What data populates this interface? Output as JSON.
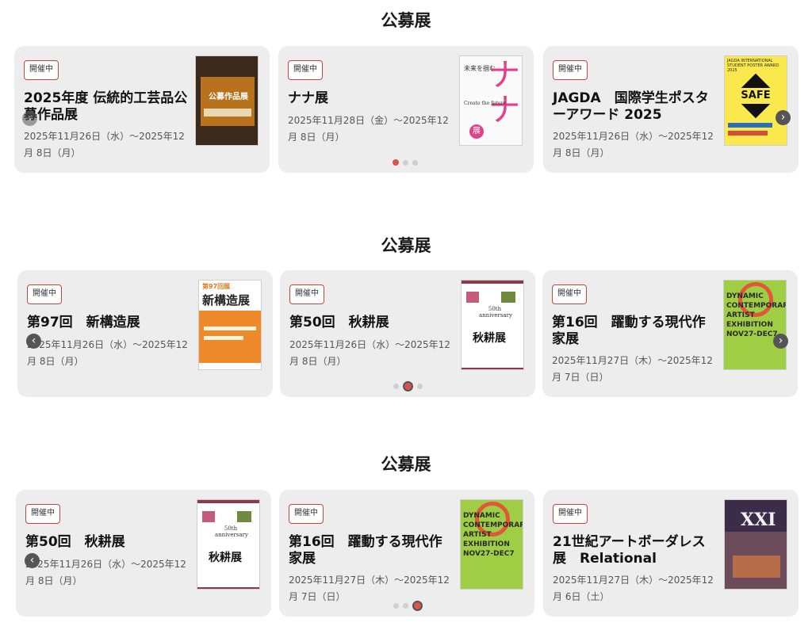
{
  "sections": [
    {
      "title": "公募展",
      "cards": [
        {
          "badge": "開催中",
          "title": "2025年度 伝統的工芸品公募作品展",
          "date": "2025年11月26日（水）～2025年12月 8日（月）"
        },
        {
          "badge": "開催中",
          "title": "ナナ展",
          "date": "2025年11月28日（金）～2025年12月 8日（月）"
        },
        {
          "badge": "開催中",
          "title": "JAGDA　国際学生ポスターアワード 2025",
          "date": "2025年11月26日（水）～2025年12月 8日（月）"
        }
      ]
    },
    {
      "title": "公募展",
      "cards": [
        {
          "badge": "開催中",
          "title": "第97回　新構造展",
          "date": "2025年11月26日（水）～2025年12月 8日（月）"
        },
        {
          "badge": "開催中",
          "title": "第50回　秋耕展",
          "date": "2025年11月26日（水）～2025年12月 8日（月）"
        },
        {
          "badge": "開催中",
          "title": "第16回　躍動する現代作家展",
          "date": "2025年11月27日（木）～2025年12月 7日（日）"
        }
      ]
    },
    {
      "title": "公募展",
      "cards": [
        {
          "badge": "開催中",
          "title": "第50回　秋耕展",
          "date": "2025年11月26日（水）～2025年12月 8日（月）"
        },
        {
          "badge": "開催中",
          "title": "第16回　躍動する現代作家展",
          "date": "2025年11月27日（木）～2025年12月 7日（日）"
        },
        {
          "badge": "開催中",
          "title": "21世紀アートボーダレス展　Relational",
          "date": "2025年11月27日（木）～2025年12月 6日（土）"
        }
      ]
    }
  ],
  "posters": {
    "dentou": "公募作品展",
    "nana_top": "未来を掴む",
    "nana_big": "ナナ",
    "nana_ten": "展",
    "nana_sub": "Create the future",
    "jagda_head": "JAGDA INTERNATIONAL STUDENT POSTER AWARD 2025",
    "jagda_safe": "SAFE",
    "shinkouzou_num": "第97回展",
    "shinkouzou_name": "新構造展",
    "shukou_50th": "50th anniversary",
    "shukou_name": "秋耕展",
    "dynamic_lines": [
      "DYNAMIC",
      "CONTEMPORARY",
      "ARTIST",
      "EXHIBITION",
      "NOV27-DEC7"
    ],
    "xxi": "XXI"
  },
  "colors": {
    "accent": "#d9534f",
    "badge_border": "#c8453b",
    "card_bg": "#ededed"
  },
  "icons": {
    "prev": "chevron-left-icon",
    "next": "chevron-right-icon"
  }
}
